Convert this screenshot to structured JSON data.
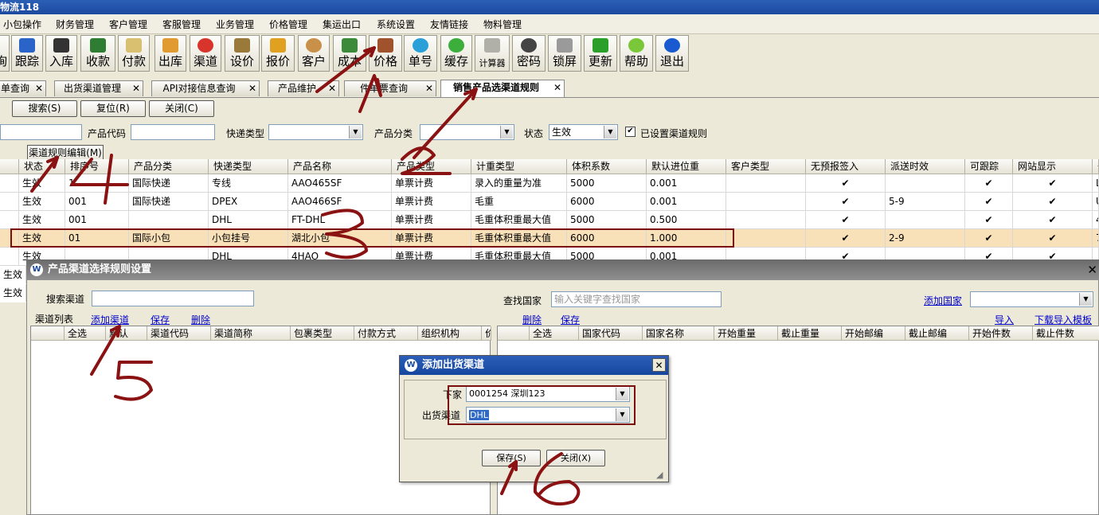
{
  "app": {
    "title": "物流118"
  },
  "menu": [
    "小包操作",
    "财务管理",
    "客户管理",
    "客服管理",
    "业务管理",
    "价格管理",
    "集运出口",
    "系统设置",
    "友情链接",
    "物料管理"
  ],
  "toolbar": [
    "询",
    "跟踪",
    "入库",
    "收款",
    "付款",
    "出库",
    "渠道",
    "设价",
    "报价",
    "客户",
    "成本",
    "价格",
    "单号",
    "缓存",
    "计算器",
    "密码",
    "锁屏",
    "更新",
    "帮助",
    "退出"
  ],
  "tabs": [
    "单查询",
    "出货渠道管理",
    "API对接信息查询",
    "产品维护",
    "件单票查询",
    "销售产品选渠道规则"
  ],
  "actions": {
    "search": "搜索(S)",
    "reset": "复位(R)",
    "close": "关闭(C)"
  },
  "filters": {
    "product_code_label": "产品代码",
    "express_type_label": "快递类型",
    "product_category_label": "产品分类",
    "status_label": "状态",
    "status_value": "生效",
    "rule_set_label": "已设置渠道规则"
  },
  "rule_edit_button": "渠道规则编辑(M)",
  "grid": {
    "headers": [
      "状态",
      "排序号",
      "产品分类",
      "快递类型",
      "产品名称",
      "产品类型",
      "计重类型",
      "体积系数",
      "默认进位重",
      "客户类型",
      "无预报签入",
      "派送时效",
      "可跟踪",
      "网站显示",
      "备"
    ],
    "rows": [
      [
        "生效",
        "1",
        "国际快递",
        "专线",
        "AAO465SF",
        "单票计费",
        "录入的重量为准",
        "5000",
        "0.001",
        "",
        "✔",
        "",
        "✔",
        "✔",
        "L"
      ],
      [
        "生效",
        "001",
        "国际快递",
        "DPEX",
        "AAO466SF",
        "单票计费",
        "毛重",
        "6000",
        "0.001",
        "",
        "✔",
        "5-9",
        "✔",
        "✔",
        "U"
      ],
      [
        "生效",
        "001",
        "",
        "DHL",
        "FT-DHL",
        "单票计费",
        "毛重体积重最大值",
        "5000",
        "0.500",
        "",
        "✔",
        "",
        "✔",
        "✔",
        "4"
      ],
      [
        "生效",
        "01",
        "国际小包",
        "小包挂号",
        "湖北小包",
        "单票计费",
        "毛重体积重最大值",
        "6000",
        "1.000",
        "",
        "✔",
        "2-9",
        "✔",
        "✔",
        "7"
      ],
      [
        "生效",
        "",
        "",
        "DHL",
        "4HAO",
        "单票计费",
        "毛重体积重最大值",
        "5000",
        "0.001",
        "",
        "✔",
        "",
        "✔",
        "✔",
        ""
      ]
    ]
  },
  "dialog": {
    "title": "产品渠道选择规则设置",
    "search_channel_label": "搜索渠道",
    "find_country_label": "查找国家",
    "find_country_placeholder": "输入关键字查找国家",
    "add_country_link": "添加国家",
    "channel_list_label": "渠道列表",
    "add_channel_link": "添加渠道",
    "save_link": "保存",
    "delete_link": "删除",
    "delete_link_right": "删除",
    "save_link_right": "保存",
    "import_link": "导入",
    "download_template_link": "下载导入模板",
    "left_headers": [
      "",
      "全选",
      "默认",
      "渠道代码",
      "渠道简称",
      "包裹类型",
      "付款方式",
      "组织机构",
      "价"
    ],
    "right_headers": [
      "",
      "全选",
      "国家代码",
      "国家名称",
      "开始重量",
      "截止重量",
      "开始邮编",
      "截止邮编",
      "开始件数",
      "截止件数"
    ]
  },
  "add_dialog": {
    "title": "添加出货渠道",
    "vendor_label": "下家",
    "vendor_value": "0001254  深圳123",
    "channel_label": "出货渠道",
    "channel_value": "DHL",
    "save_button": "保存(S)",
    "close_button": "关闭(X)"
  },
  "annotations": [
    "1",
    "2",
    "3",
    "4",
    "5",
    "6"
  ]
}
